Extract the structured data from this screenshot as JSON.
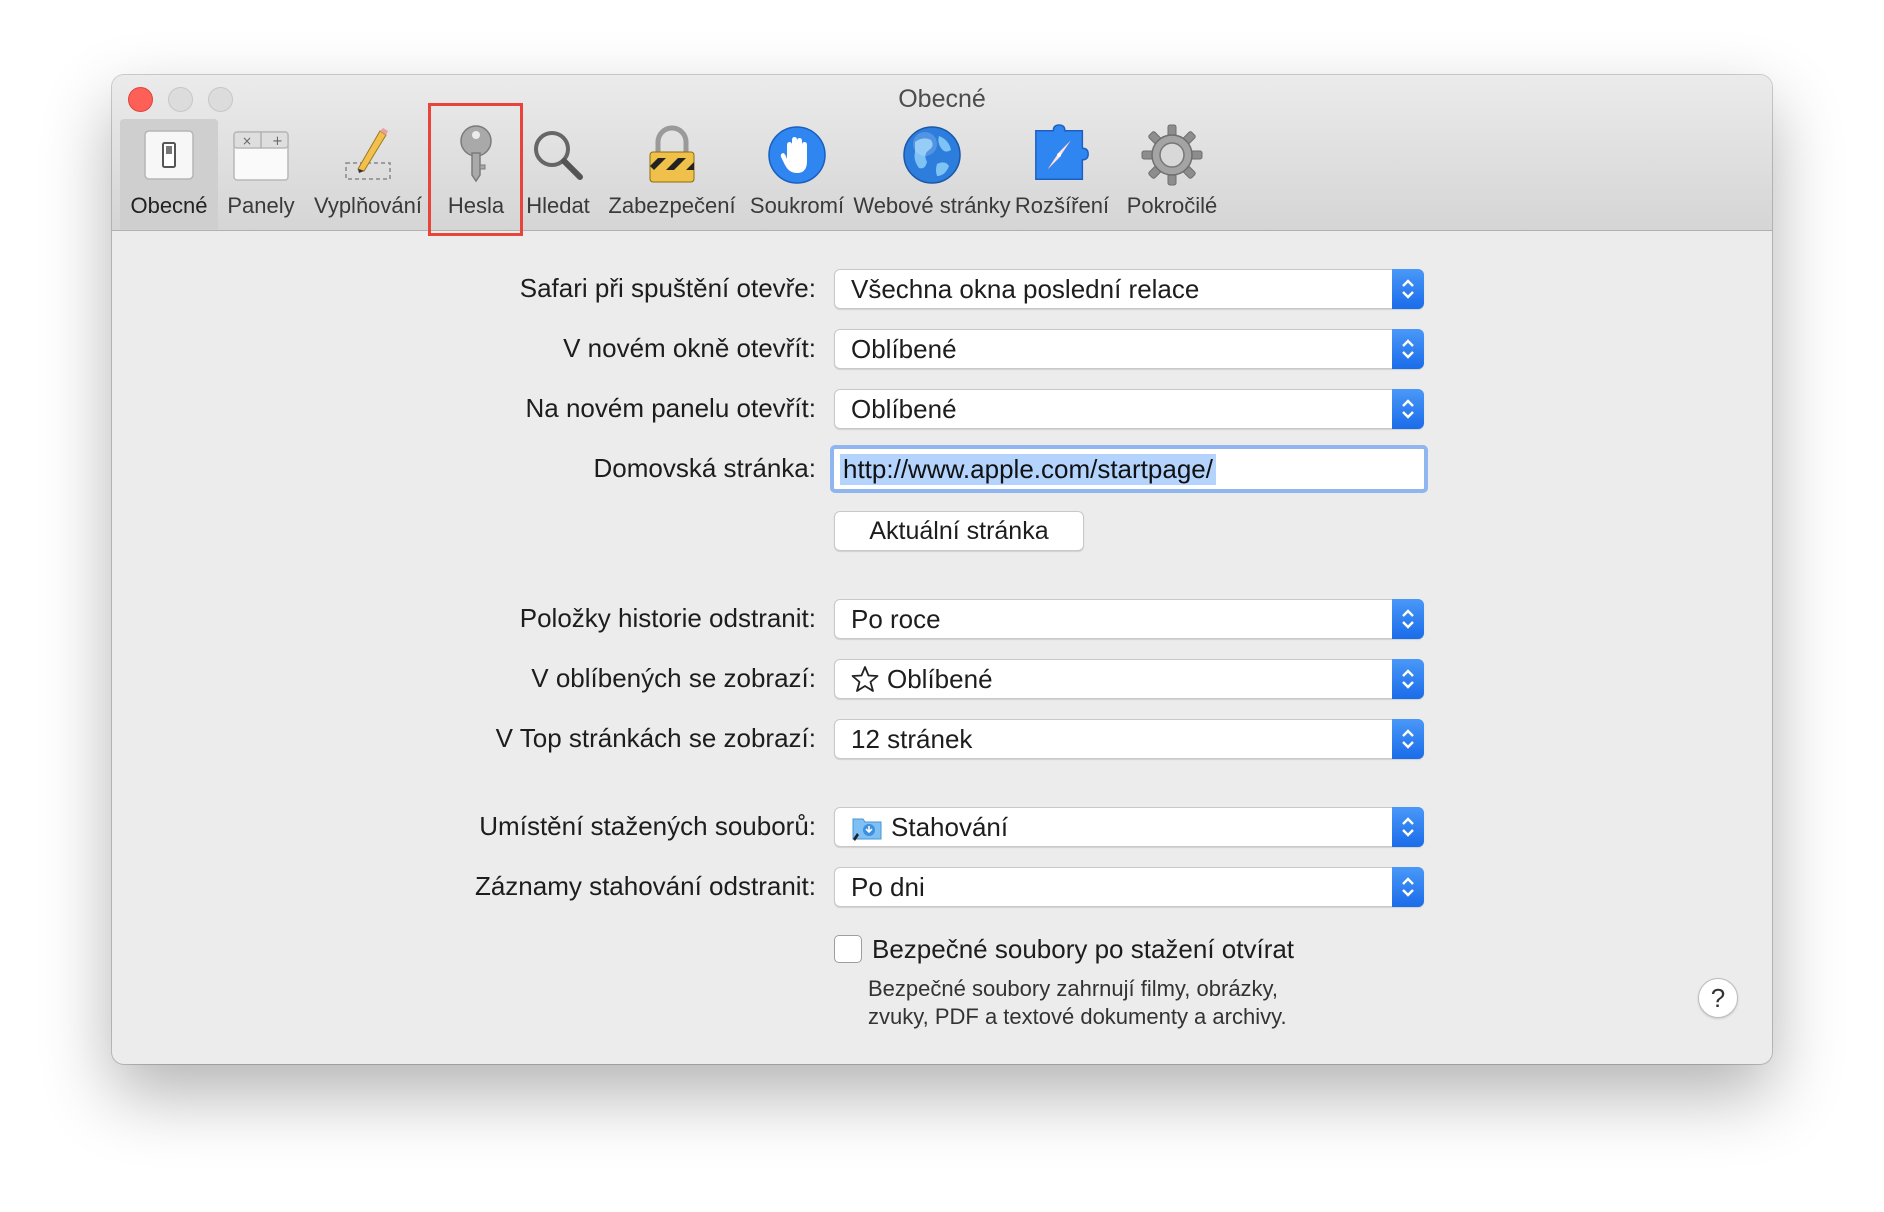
{
  "window": {
    "title": "Obecné"
  },
  "toolbar": {
    "items": [
      {
        "label": "Obecné",
        "icon": "general-switch-icon",
        "active": true
      },
      {
        "label": "Panely",
        "icon": "tabs-icon"
      },
      {
        "label": "Vyplňování",
        "icon": "autofill-pencil-icon"
      },
      {
        "label": "Hesla",
        "icon": "key-icon",
        "highlighted": true
      },
      {
        "label": "Hledat",
        "icon": "magnifier-icon"
      },
      {
        "label": "Zabezpečení",
        "icon": "padlock-icon"
      },
      {
        "label": "Soukromí",
        "icon": "privacy-hand-icon"
      },
      {
        "label": "Webové stránky",
        "icon": "globe-icon"
      },
      {
        "label": "Rozšíření",
        "icon": "extensions-puzzle-icon"
      },
      {
        "label": "Pokročilé",
        "icon": "gear-icon"
      }
    ],
    "highlight_color": "#e8443a"
  },
  "settings": {
    "open_with": {
      "label": "Safari při spuštění otevře:",
      "value": "Všechna okna poslední relace"
    },
    "new_window": {
      "label": "V novém okně otevřít:",
      "value": "Oblíbené"
    },
    "new_tab": {
      "label": "Na novém panelu otevřít:",
      "value": "Oblíbené"
    },
    "homepage": {
      "label": "Domovská stránka:",
      "value": "http://www.apple.com/startpage/"
    },
    "current_page_button": "Aktuální stránka",
    "history_remove": {
      "label": "Položky historie odstranit:",
      "value": "Po roce"
    },
    "favorites_show": {
      "label": "V oblíbených se zobrazí:",
      "value": "Oblíbené",
      "icon": "star-icon"
    },
    "top_sites": {
      "label": "V Top stránkách se zobrazí:",
      "value": "12 stránek"
    },
    "download_location": {
      "label": "Umístění stažených souborů:",
      "value": "Stahování",
      "icon": "downloads-folder-icon"
    },
    "download_remove": {
      "label": "Záznamy stahování odstranit:",
      "value": "Po dni"
    },
    "safe_files": {
      "label": "Bezpečné soubory po stažení otvírat",
      "checked": false,
      "help_line1": "Bezpečné soubory zahrnují filmy, obrázky,",
      "help_line2": "zvuky, PDF a textové dokumenty a archivy."
    },
    "help_button": "?"
  },
  "colors": {
    "accent_blue": "#1a6ce9",
    "close_red": "#fe5f57",
    "selection": "#b4d4fe"
  }
}
